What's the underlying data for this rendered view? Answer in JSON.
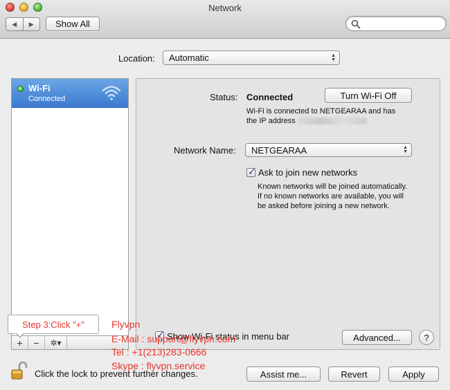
{
  "window": {
    "title": "Network"
  },
  "toolbar": {
    "show_all_label": "Show All",
    "search_placeholder": ""
  },
  "location": {
    "label": "Location:",
    "value": "Automatic"
  },
  "services": [
    {
      "name": "Wi-Fi",
      "status": "Connected",
      "status_color": "#3dbf2e"
    }
  ],
  "detail": {
    "status_label": "Status:",
    "status_value": "Connected",
    "turn_off_label": "Turn Wi-Fi Off",
    "status_desc_line1": "Wi-Fi is connected to NETGEARAA and has",
    "status_desc_line2": "the IP address",
    "network_name_label": "Network Name:",
    "network_name_value": "NETGEARAA",
    "ask_join_label": "Ask to join new networks",
    "ask_join_checked": true,
    "ask_desc_line1": "Known networks will be joined automatically.",
    "ask_desc_line2": "If no known networks are available, you will",
    "ask_desc_line3": "be asked before joining a new network.",
    "show_wifi_label": "Show Wi-Fi status in menu bar",
    "show_wifi_checked": true,
    "advanced_label": "Advanced...",
    "help_label": "?"
  },
  "list_tools": {
    "plus": "+",
    "minus": "−",
    "gear": "✲▾"
  },
  "footer": {
    "lock_text": "Click the lock to prevent further changes.",
    "assist_label": "Assist me...",
    "revert_label": "Revert",
    "apply_label": "Apply"
  },
  "annotation": {
    "callout": "Step 3:Click \"+\"",
    "brand": "Flyvpn",
    "email": "E-Mail : support@flyvpn.com",
    "tel": "Tel : +1(213)283-0666",
    "skype": "Skype : flyvpn.service",
    "color": "#e8322b"
  }
}
